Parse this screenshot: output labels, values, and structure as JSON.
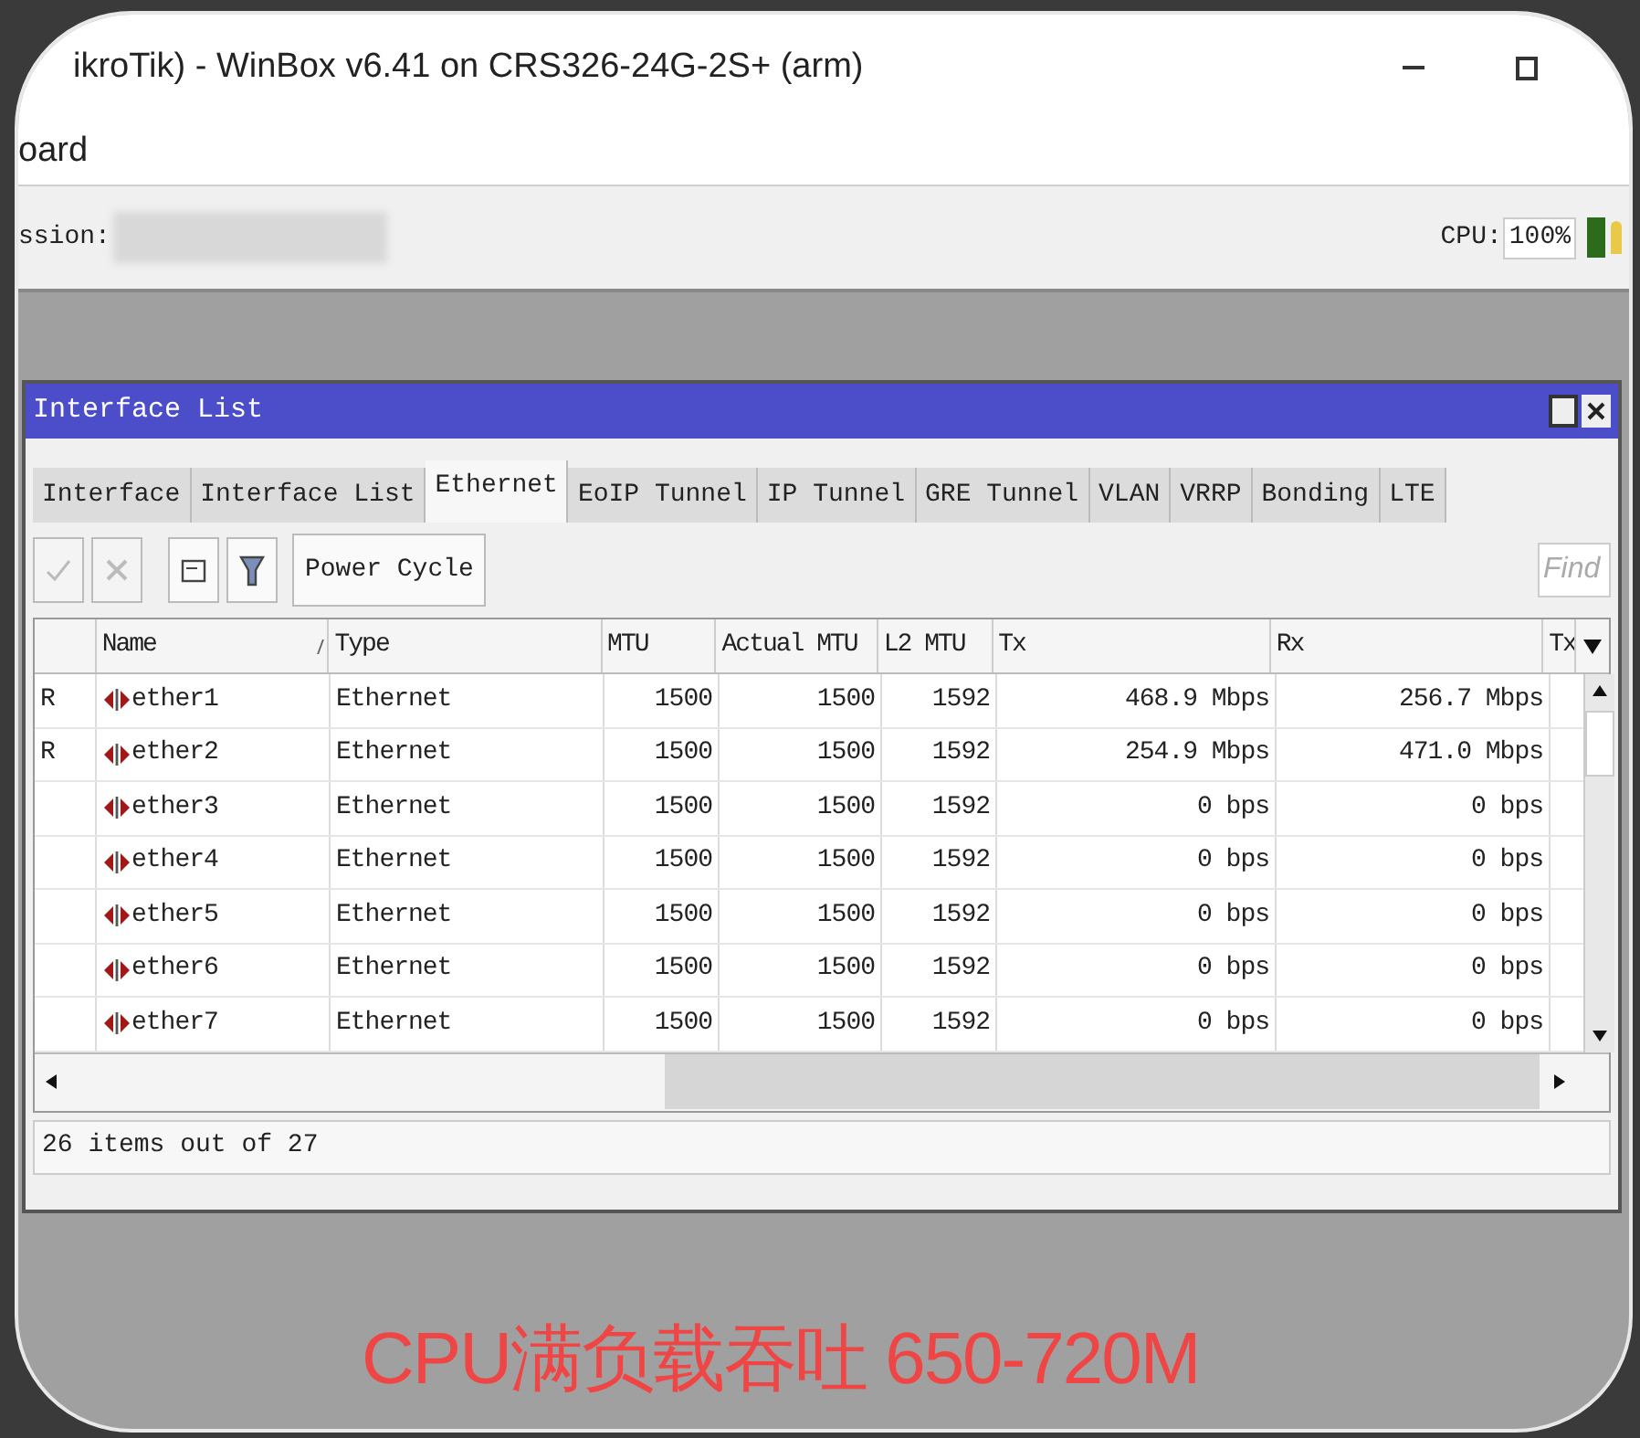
{
  "window": {
    "title": "ikroTik) - WinBox v6.41 on CRS326-24G-2S+ (arm)"
  },
  "menu": [
    "oard"
  ],
  "toolbar": {
    "session_label": "ssion:",
    "cpu_label": "CPU:",
    "cpu_value": "100%"
  },
  "interface_window": {
    "title": "Interface List",
    "tabs": [
      {
        "label": "Interface",
        "selected": false
      },
      {
        "label": "Interface List",
        "selected": false
      },
      {
        "label": "Ethernet",
        "selected": true
      },
      {
        "label": "EoIP Tunnel",
        "selected": false
      },
      {
        "label": "IP Tunnel",
        "selected": false
      },
      {
        "label": "GRE Tunnel",
        "selected": false
      },
      {
        "label": "VLAN",
        "selected": false
      },
      {
        "label": "VRRP",
        "selected": false
      },
      {
        "label": "Bonding",
        "selected": false
      },
      {
        "label": "LTE",
        "selected": false
      }
    ],
    "tool_buttons": [
      {
        "kind": "enable",
        "disabled": true
      },
      {
        "kind": "disable",
        "disabled": true
      },
      {
        "kind": "comment",
        "disabled": false
      },
      {
        "kind": "filter",
        "disabled": false
      }
    ],
    "power_cycle_button": "Power Cycle",
    "find": {
      "placeholder": "Find"
    },
    "table": {
      "columns": [
        "Name",
        "Type",
        "MTU",
        "Actual MTU",
        "L2 MTU",
        "Tx",
        "Rx",
        "Tx"
      ],
      "rows": [
        {
          "flag": "R",
          "name": "ether1",
          "type": "Ethernet",
          "mtu": "1500",
          "actual_mtu": "1500",
          "l2_mtu": "1592",
          "tx": "468.9 Mbps",
          "rx": "256.7 Mbps"
        },
        {
          "flag": "R",
          "name": "ether2",
          "type": "Ethernet",
          "mtu": "1500",
          "actual_mtu": "1500",
          "l2_mtu": "1592",
          "tx": "254.9 Mbps",
          "rx": "471.0 Mbps"
        },
        {
          "name": "ether3",
          "type": "Ethernet",
          "mtu": "1500",
          "actual_mtu": "1500",
          "l2_mtu": "1592",
          "tx": "0 bps",
          "rx": "0 bps"
        },
        {
          "name": "ether4",
          "type": "Ethernet",
          "mtu": "1500",
          "actual_mtu": "1500",
          "l2_mtu": "1592",
          "tx": "0 bps",
          "rx": "0 bps"
        },
        {
          "name": "ether5",
          "type": "Ethernet",
          "mtu": "1500",
          "actual_mtu": "1500",
          "l2_mtu": "1592",
          "tx": "0 bps",
          "rx": "0 bps"
        },
        {
          "name": "ether6",
          "type": "Ethernet",
          "mtu": "1500",
          "actual_mtu": "1500",
          "l2_mtu": "1592",
          "tx": "0 bps",
          "rx": "0 bps"
        },
        {
          "name": "ether7",
          "type": "Ethernet",
          "mtu": "1500",
          "actual_mtu": "1500",
          "l2_mtu": "1592",
          "tx": "0 bps",
          "rx": "0 bps"
        }
      ]
    },
    "status": "26 items out of 27"
  },
  "caption": "CPU满负载吞吐 650-720M"
}
